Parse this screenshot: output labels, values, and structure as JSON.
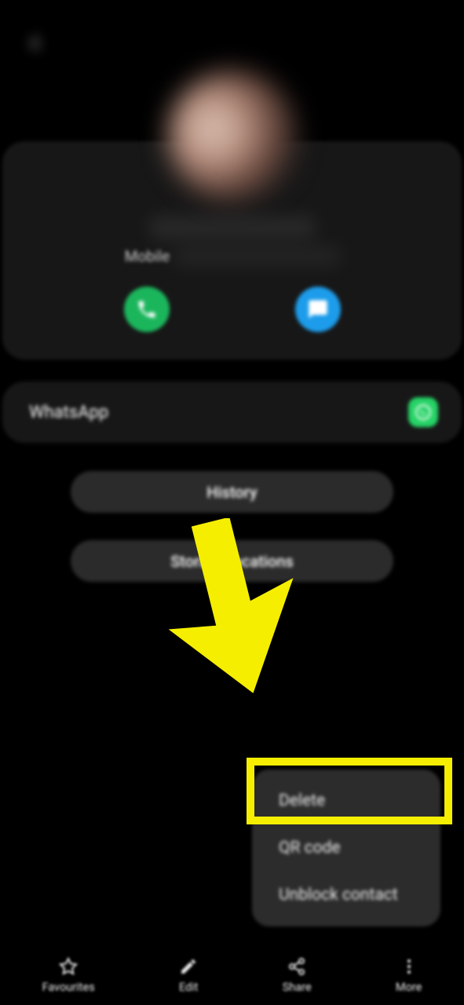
{
  "contact": {
    "phone_type": "Mobile"
  },
  "apps": {
    "whatsapp_label": "WhatsApp"
  },
  "buttons": {
    "history": "History",
    "storage": "Storage locations"
  },
  "popup": {
    "delete": "Delete",
    "qr_code": "QR code",
    "unblock": "Unblock contact"
  },
  "bottom_bar": {
    "favourites": "Favourites",
    "edit": "Edit",
    "share": "Share",
    "more": "More"
  }
}
